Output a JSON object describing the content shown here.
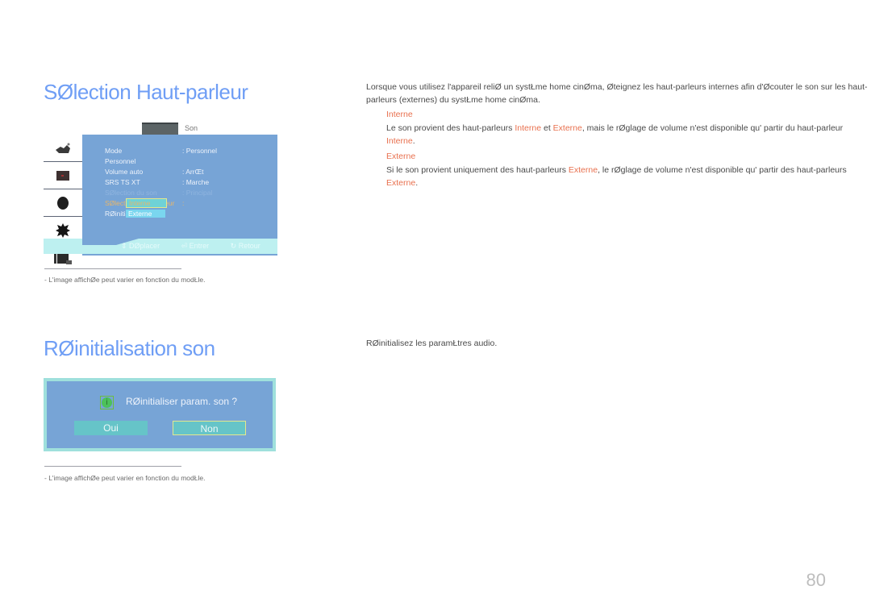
{
  "section1": {
    "title": "SØlection Haut-parleur",
    "osd": {
      "tab_label": "Son",
      "menu": [
        {
          "label": "Mode",
          "value": ": Personnel",
          "state": "normal"
        },
        {
          "label": "Personnel",
          "value": "",
          "state": "normal"
        },
        {
          "label": "Volume auto",
          "value": ": ArrŒt",
          "state": "normal"
        },
        {
          "label": "SRS TS XT",
          "value": ": Marche",
          "state": "normal"
        },
        {
          "label": "SØlection du son",
          "value": ": Principal",
          "state": "disabled"
        },
        {
          "label": "SØlection Haut-parleur",
          "value": ":",
          "state": "active"
        },
        {
          "label": "RØinitialisation son",
          "value": "",
          "state": "normal"
        }
      ],
      "options": [
        "Interne",
        "Externe"
      ],
      "selected_option": "Interne",
      "footer": {
        "move": "DØplacer",
        "enter": "Entrer",
        "back": "Retour"
      },
      "side_icons": [
        "picture-icon",
        "screen-icon",
        "sound-icon",
        "setup-icon",
        "input-icon"
      ]
    },
    "caption": "-   L'image affichØe peut varier en fonction du modŁle.",
    "intro": "Lorsque vous utilisez l'appareil reliØ   un systŁme home cinØma, Øteignez les haut-parleurs internes afin d'Øcouter le son sur les haut-parleurs (externes) du systŁme home cinØma.",
    "items": [
      {
        "term": "Interne",
        "desc_parts": [
          {
            "t": "Le son provient des haut-parleurs ",
            "hl": false
          },
          {
            "t": "Interne",
            "hl": true
          },
          {
            "t": " et ",
            "hl": false
          },
          {
            "t": "Externe",
            "hl": true
          },
          {
            "t": ", mais le rØglage de volume n'est disponible qu'  partir du haut-parleur ",
            "hl": false
          },
          {
            "t": "Interne",
            "hl": true
          },
          {
            "t": ".",
            "hl": false
          }
        ]
      },
      {
        "term": "Externe",
        "desc_parts": [
          {
            "t": "Si le son provient uniquement des haut-parleurs ",
            "hl": false
          },
          {
            "t": "Externe",
            "hl": true
          },
          {
            "t": ", le rØglage de volume n'est disponible qu'  partir des haut-parleurs ",
            "hl": false
          },
          {
            "t": "Externe",
            "hl": true
          },
          {
            "t": ".",
            "hl": false
          }
        ]
      }
    ]
  },
  "section2": {
    "title": "RØinitialisation son",
    "dialog": {
      "question": "RØinitialiser param. son ?",
      "yes_label": "Oui",
      "no_label": "Non",
      "focused": "Non"
    },
    "caption": "-   L'image affichØe peut varier en fonction du modŁle.",
    "description": "RØinitialisez les paramŁtres audio."
  },
  "page_number": "80",
  "colors": {
    "title": "#6f9ef5",
    "highlight": "#e8704e",
    "osd_panel": "#77a4d6",
    "osd_footer": "#bdf0f0"
  }
}
